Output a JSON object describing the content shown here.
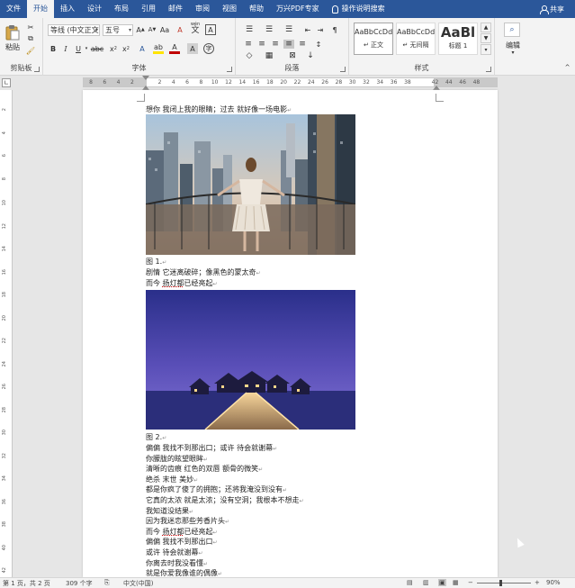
{
  "tabs": [
    {
      "label": "文件",
      "active": false
    },
    {
      "label": "开始",
      "active": true
    },
    {
      "label": "插入",
      "active": false
    },
    {
      "label": "设计",
      "active": false
    },
    {
      "label": "布局",
      "active": false
    },
    {
      "label": "引用",
      "active": false
    },
    {
      "label": "邮件",
      "active": false
    },
    {
      "label": "审阅",
      "active": false
    },
    {
      "label": "视图",
      "active": false
    },
    {
      "label": "帮助",
      "active": false
    },
    {
      "label": "万兴PDF专家",
      "active": false
    }
  ],
  "tell_me": "操作说明搜索",
  "share": "共享",
  "ribbon": {
    "clipboard": {
      "paste": "粘贴",
      "label": "剪贴板"
    },
    "font": {
      "font_name": "等线 (中文正文)",
      "font_size": "五号",
      "wen_char": "wén",
      "label": "字体"
    },
    "paragraph": {
      "label": "段落"
    },
    "styles": {
      "label": "样式",
      "items": [
        {
          "preview": "AaBbCcDd",
          "name": "↵ 正文"
        },
        {
          "preview": "AaBbCcDd",
          "name": "↵ 无间隔"
        },
        {
          "preview": "AaBl",
          "name": "标题 1"
        }
      ]
    },
    "editing": {
      "label": "编辑"
    }
  },
  "ruler_numbers": [
    "8",
    "6",
    "4",
    "2",
    "",
    "2",
    "4",
    "6",
    "8",
    "10",
    "12",
    "14",
    "16",
    "18",
    "20",
    "22",
    "24",
    "26",
    "28",
    "30",
    "32",
    "34",
    "36",
    "38",
    "",
    "42",
    "44",
    "46",
    "48"
  ],
  "vruler_numbers": [
    "2",
    "4",
    "6",
    "8",
    "10",
    "12",
    "14",
    "16",
    "18",
    "20",
    "22",
    "24",
    "26",
    "28",
    "30",
    "32",
    "34",
    "36",
    "38",
    "40",
    "42"
  ],
  "document": {
    "line_top": "想你 我闭上我的眼睛；过去 就好像一场电影",
    "caption1": "图 1.",
    "lines_mid": [
      {
        "pre": "剧情 它迷离破碎；像黑色的蒙太奇",
        "u": "",
        "post": ""
      },
      {
        "pre": "而今 ",
        "u": "扬灯都",
        "post": "已经亮起"
      }
    ],
    "caption2": "图 2.",
    "lines_bottom": [
      {
        "pre": "偏偏 我找不到那出口；或许 待会就谢幕",
        "u": "",
        "post": ""
      },
      {
        "pre": "你朦胧的眩望眼眸",
        "u": "",
        "post": ""
      },
      {
        "pre": "清晰的齿痕 红色的双唇 额骨的微笑",
        "u": "",
        "post": ""
      },
      {
        "pre": "绝杀 末世 美妙",
        "u": "",
        "post": ""
      },
      {
        "pre": "都是你疯了傻了的拥抱；还将我淹没到没有",
        "u": "",
        "post": ""
      },
      {
        "pre": "它真的太浓 就是太浓；没有空洞；我根本不想走",
        "u": "",
        "post": ""
      },
      {
        "pre": "我知道没结果",
        "u": "",
        "post": ""
      },
      {
        "pre": "因为我迷恋那些芳香片头",
        "u": "",
        "post": ""
      },
      {
        "pre": "而今 ",
        "u": "扬灯都",
        "post": "已经亮起"
      },
      {
        "pre": "偏偏 我找不到那出口",
        "u": "",
        "post": ""
      },
      {
        "pre": "或许 待会就谢幕",
        "u": "",
        "post": ""
      },
      {
        "pre": "你离去时我没看懂",
        "u": "",
        "post": ""
      },
      {
        "pre": "就是你爱我像谁的偶像",
        "u": "",
        "post": ""
      }
    ]
  },
  "status": {
    "page": "第 1 页，共 2 页",
    "words": "309 个字",
    "lang": "中文(中国)",
    "zoom": "90%",
    "zoom_level": 0.9
  },
  "colors": {
    "accent": "#2b579a",
    "ribbon_bg": "#f3f3f3",
    "canvas": "#e6e6e6"
  }
}
